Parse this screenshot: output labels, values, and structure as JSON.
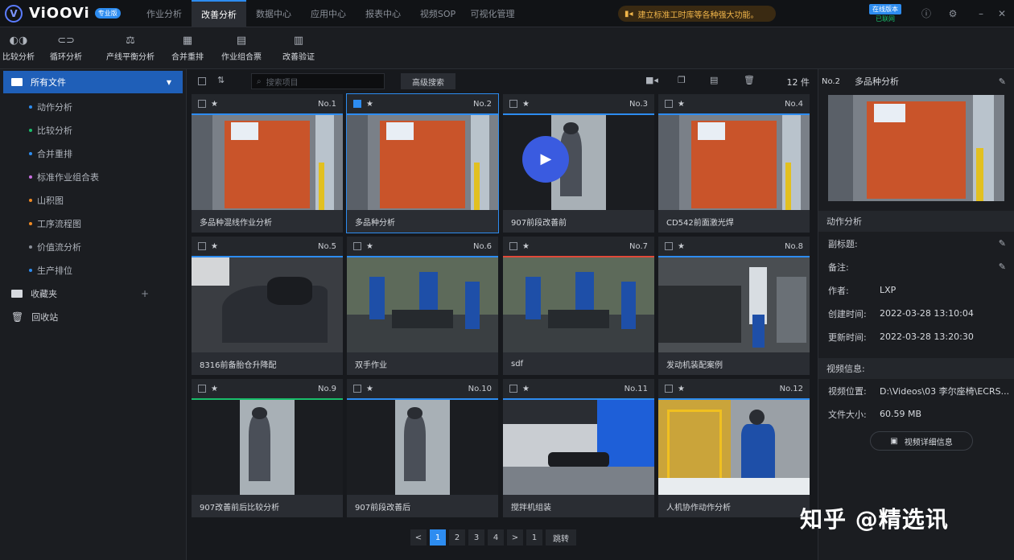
{
  "app": {
    "name": "ViOOVi",
    "badge": "专业版"
  },
  "nav": [
    "作业分析",
    "改善分析",
    "数据中心",
    "应用中心",
    "报表中心",
    "视频SOP",
    "可视化管理"
  ],
  "nav_active": 1,
  "notice": "建立标准工时库等各种强大功能。",
  "status": {
    "label": "在线版本",
    "online": "已联网"
  },
  "toolbar": [
    "比较分析",
    "循环分析",
    "产线平衡分析",
    "合并重排",
    "作业组合票",
    "改善验证"
  ],
  "sidebar": {
    "root": "所有文件",
    "items": [
      {
        "label": "动作分析",
        "color": "#2d8cf0"
      },
      {
        "label": "比较分析",
        "color": "#19be6b"
      },
      {
        "label": "合并重排",
        "color": "#2d8cf0"
      },
      {
        "label": "标准作业组合表",
        "color": "#c86ee0"
      },
      {
        "label": "山积图",
        "color": "#f08a24"
      },
      {
        "label": "工序流程图",
        "color": "#f08a24"
      },
      {
        "label": "价值流分析",
        "color": "#8a8f98"
      },
      {
        "label": "生产排位",
        "color": "#2d8cf0"
      }
    ],
    "favorites": "收藏夹",
    "recycle": "回收站"
  },
  "grid": {
    "search_placeholder": "搜索项目",
    "adv_search": "高级搜索",
    "count": "12 件",
    "cards": [
      {
        "no": "No.1",
        "title": "多品种混线作业分析",
        "line": "#2d8cf0",
        "scene": "orange"
      },
      {
        "no": "No.2",
        "title": "多品种分析",
        "line": "#2d8cf0",
        "scene": "orange",
        "selected": true
      },
      {
        "no": "No.3",
        "title": "907前段改善前",
        "line": "#2d8cf0",
        "scene": "portrait_play"
      },
      {
        "no": "No.4",
        "title": "CD542前面激光焊",
        "line": "#2d8cf0",
        "scene": "orange"
      },
      {
        "no": "No.5",
        "title": "8316前备胎仓升降配",
        "line": "#2d8cf0",
        "scene": "dark"
      },
      {
        "no": "No.6",
        "title": "双手作业",
        "line": "#2d8cf0",
        "scene": "factory"
      },
      {
        "no": "No.7",
        "title": "sdf",
        "line": "#e04a3a",
        "scene": "factory"
      },
      {
        "no": "No.8",
        "title": "发动机装配案例",
        "line": "#2d8cf0",
        "scene": "engine"
      },
      {
        "no": "No.9",
        "title": "907改善前后比较分析",
        "line": "#19be6b",
        "scene": "portrait"
      },
      {
        "no": "No.10",
        "title": "907前段改善后",
        "line": "#2d8cf0",
        "scene": "portrait"
      },
      {
        "no": "No.11",
        "title": "搅拌机组装",
        "line": "#2d8cf0",
        "scene": "blue"
      },
      {
        "no": "No.12",
        "title": "人机协作动作分析",
        "line": "#2d8cf0",
        "scene": "yellow"
      }
    ]
  },
  "pager": {
    "pages": [
      "1",
      "2",
      "3",
      "4"
    ],
    "active": 0,
    "goto_value": "1",
    "goto": "跳转",
    "prev": "<",
    "next": ">"
  },
  "panel": {
    "no": "No.2",
    "title": "多品种分析",
    "section_motion": "动作分析",
    "sub_title_label": "副标题:",
    "note_label": "备注:",
    "author_label": "作者:",
    "author": "LXP",
    "created_label": "创建时间:",
    "created": "2022-03-28 13:10:04",
    "updated_label": "更新时间:",
    "updated": "2022-03-28 13:20:30",
    "section_video": "视频信息:",
    "video_path_label": "视频位置:",
    "video_path": "D:\\Videos\\03 李尔座椅\\ECRS...",
    "file_size_label": "文件大小:",
    "file_size": "60.59 MB",
    "video_btn": "视频详细信息"
  },
  "watermark": "知乎 @精选讯"
}
